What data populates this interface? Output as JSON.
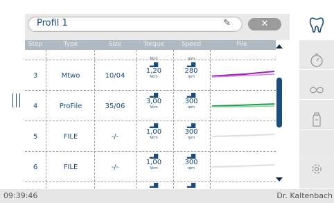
{
  "profile": {
    "name": "Profil 1",
    "edit_icon": "pencil-icon",
    "close_label": "✕"
  },
  "table": {
    "headers": [
      "Step",
      "Type",
      "Size",
      "Torque",
      "Speed",
      "File"
    ],
    "torque_unit": "Ncm",
    "speed_unit": "rpm",
    "rows": [
      {
        "step": "3",
        "type": "Mtwo",
        "size": "10/04",
        "torque": "1,20",
        "speed": "280",
        "file_color": "#9b1fb0"
      },
      {
        "step": "4",
        "type": "ProFile",
        "size": "35/06",
        "torque": "3,00",
        "speed": "300",
        "file_color": "#1f9b4a"
      },
      {
        "step": "5",
        "type": "FILE",
        "size": "-/-",
        "torque": "1,00",
        "speed": "300",
        "file_color": "#dddddd"
      },
      {
        "step": "6",
        "type": "FILE",
        "size": "-/-",
        "torque": "1,00",
        "speed": "300",
        "file_color": "#dddddd"
      }
    ]
  },
  "nav": {
    "icons": [
      "tooth-icon",
      "timer-icon",
      "infinity-loop-icon",
      "bottle-icon",
      "settings-gear-icon"
    ]
  },
  "status": {
    "time": "09:39:46",
    "user": "Dr. Kaltenbach"
  }
}
